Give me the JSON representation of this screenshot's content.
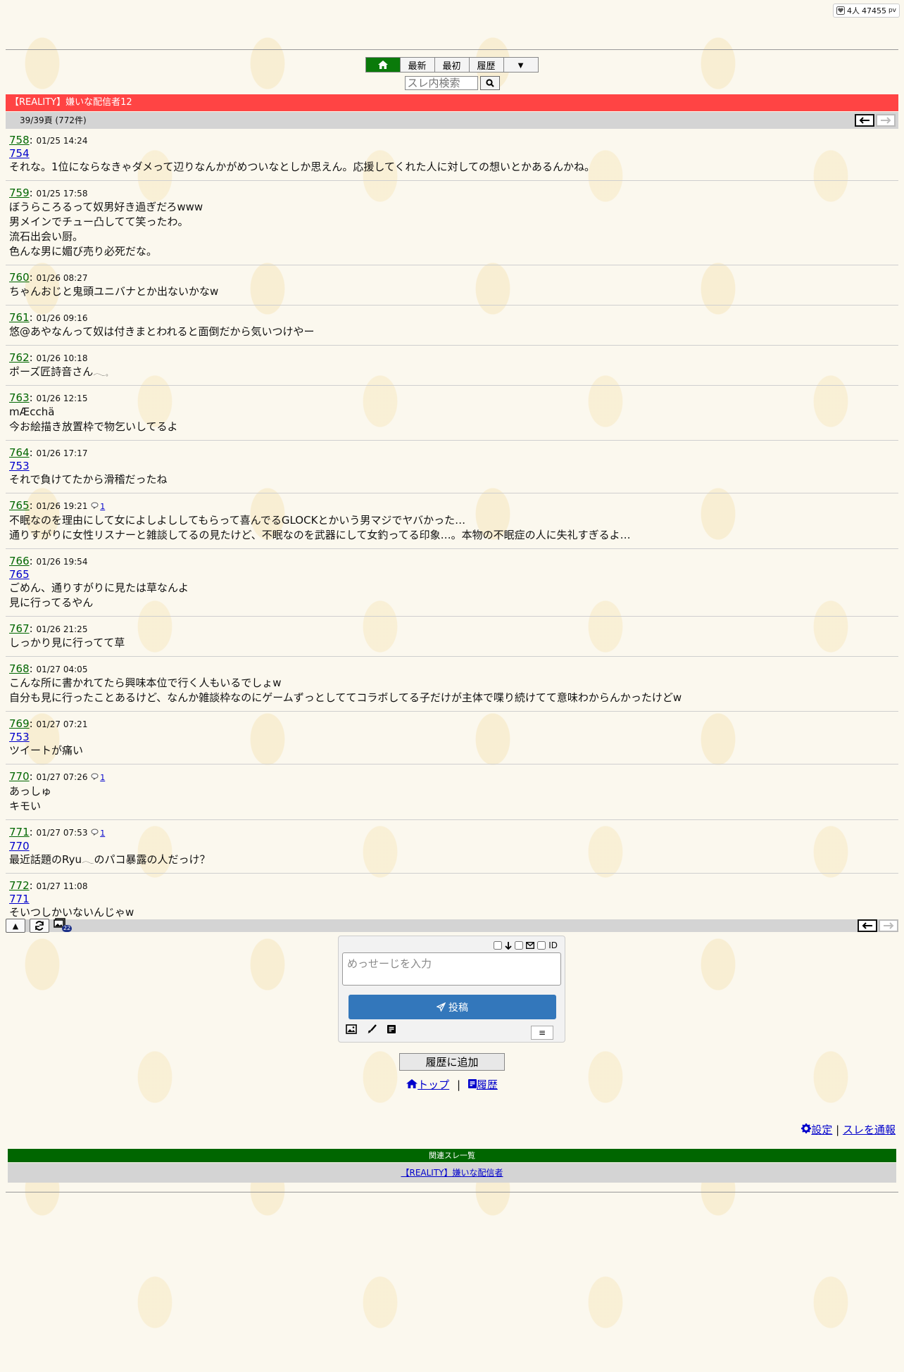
{
  "counter": {
    "users": "4人",
    "views": "47455",
    "unit": "pv"
  },
  "nav": {
    "latest": "最新",
    "first": "最初",
    "history": "履歴",
    "more": "▼"
  },
  "search": {
    "placeholder": "スレ内検索"
  },
  "thread": {
    "title": "【REALITY】嫌いな配信者12",
    "page": "39/39頁 (772件)"
  },
  "posts": [
    {
      "num": "758",
      "date": "01/25 14:24",
      "anchor": "754",
      "replies": "",
      "lines": [
        "それな。1位にならなきゃダメって辺りなんかがめついなとしか思えん。応援してくれた人に対しての想いとかあるんかね。"
      ]
    },
    {
      "num": "759",
      "date": "01/25 17:58",
      "anchor": "",
      "replies": "",
      "lines": [
        "ぼうらころるって奴男好き過ぎだろwww",
        "男メインでチュー凸してて笑ったわ。",
        "流石出会い厨。",
        "色んな男に媚び売り必死だな。"
      ]
    },
    {
      "num": "760",
      "date": "01/26 08:27",
      "anchor": "",
      "replies": "",
      "lines": [
        "ちゃんおじと鬼頭ユニバナとか出ないかなw"
      ]
    },
    {
      "num": "761",
      "date": "01/26 09:16",
      "anchor": "",
      "replies": "",
      "lines": [
        "悠@あやなんって奴は付きまとわれると面倒だから気いつけやー"
      ]
    },
    {
      "num": "762",
      "date": "01/26 10:18",
      "anchor": "",
      "replies": "",
      "lines": [
        "ポーズ匠詩音さん𓂃𓈒"
      ]
    },
    {
      "num": "763",
      "date": "01/26 12:15",
      "anchor": "",
      "replies": "",
      "lines": [
        "mÆcchä",
        "今お絵描き放置枠で物乞いしてるよ"
      ]
    },
    {
      "num": "764",
      "date": "01/26 17:17",
      "anchor": "753",
      "replies": "",
      "lines": [
        "それで負けてたから滑稽だったね"
      ]
    },
    {
      "num": "765",
      "date": "01/26 19:21",
      "anchor": "",
      "replies": "1",
      "lines": [
        "不眠なのを理由にして女によしよししてもらって喜んでるGLOCKとかいう男マジでヤバかった…",
        "通りすがりに女性リスナーと雑談してるの見たけど、不眠なのを武器にして女釣ってる印象…。本物の不眠症の人に失礼すぎるよ…"
      ]
    },
    {
      "num": "766",
      "date": "01/26 19:54",
      "anchor": "765",
      "replies": "",
      "lines": [
        "ごめん、通りすがりに見たは草なんよ",
        "見に行ってるやん"
      ]
    },
    {
      "num": "767",
      "date": "01/26 21:25",
      "anchor": "",
      "replies": "",
      "lines": [
        "しっかり見に行ってて草"
      ]
    },
    {
      "num": "768",
      "date": "01/27 04:05",
      "anchor": "",
      "replies": "",
      "lines": [
        "こんな所に書かれてたら興味本位で行く人もいるでしょw",
        "自分も見に行ったことあるけど、なんか雑談枠なのにゲームずっとしててコラボしてる子だけが主体で喋り続けてて意味わからんかったけどw"
      ]
    },
    {
      "num": "769",
      "date": "01/27 07:21",
      "anchor": "753",
      "replies": "",
      "lines": [
        "ツイートが痛い"
      ]
    },
    {
      "num": "770",
      "date": "01/27 07:26",
      "anchor": "",
      "replies": "1",
      "lines": [
        "あっしゅ",
        "キモい"
      ]
    },
    {
      "num": "771",
      "date": "01/27 07:53",
      "anchor": "770",
      "replies": "1",
      "lines": [
        "最近話題のRyu𓂃のパコ暴露の人だっけ？"
      ]
    },
    {
      "num": "772",
      "date": "01/27 11:08",
      "anchor": "771",
      "replies": "",
      "lines": [
        "そいつしかいないんじゃw"
      ]
    }
  ],
  "bottom": {
    "top_btn": "▲",
    "badge": "22"
  },
  "form": {
    "placeholder": "めっせーじを入力",
    "opt_id": "ID",
    "submit": "投稿",
    "menu": "≡"
  },
  "footer": {
    "add_history": "履歴に追加",
    "top_link": "トップ",
    "sep": "|",
    "history_link": "履歴",
    "settings": "設定",
    "report": "スレを通報",
    "related_title": "関連スレ一覧",
    "related_link": "【REALITY】嫌いな配信者"
  }
}
